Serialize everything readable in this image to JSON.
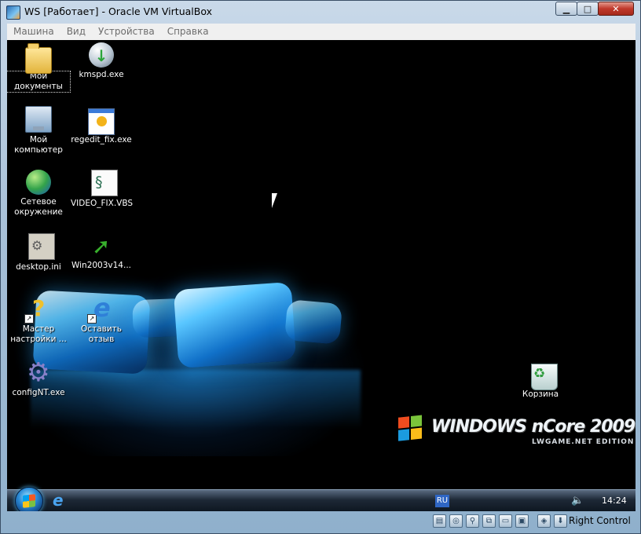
{
  "window": {
    "title": "WS [Работает] - Oracle VM VirtualBox",
    "buttons": {
      "minimize": "▁",
      "maximize": "□",
      "close": "✕"
    }
  },
  "menu": [
    "Машина",
    "Вид",
    "Устройства",
    "Справка"
  ],
  "desktop_icons": [
    {
      "label_1": "Мои",
      "label_2": "документы",
      "icon": "my-documents-folder-icon"
    },
    {
      "label_1": "kmspd.exe",
      "label_2": "",
      "icon": "globe-download-icon"
    },
    {
      "label_1": "Мой",
      "label_2": "компьютер",
      "icon": "computer-icon"
    },
    {
      "label_1": "regedit_fix.exe",
      "label_2": "",
      "icon": "application-icon"
    },
    {
      "label_1": "Сетевое",
      "label_2": "окружение",
      "icon": "network-globe-icon"
    },
    {
      "label_1": "VIDEO_FIX.VBS",
      "label_2": "",
      "icon": "script-icon"
    },
    {
      "label_1": "desktop.ini",
      "label_2": "",
      "icon": "ini-file-icon"
    },
    {
      "label_1": "Win2003v14...",
      "label_2": "",
      "icon": "green-arrow-icon"
    },
    {
      "label_1": "Мастер",
      "label_2": "настройки ...",
      "icon": "wizard-icon"
    },
    {
      "label_1": "Оставить",
      "label_2": "отзыв",
      "icon": "internet-explorer-icon"
    },
    {
      "label_1": "configNT.exe",
      "label_2": "",
      "icon": "gear-icon"
    },
    {
      "label_1": "Корзина",
      "label_2": "",
      "icon": "recycle-bin-icon"
    }
  ],
  "wallpaper": {
    "brand": "WINDOWS nCore 2009",
    "edition": "LWGAME.NET EDITION"
  },
  "taskbar": {
    "language": "RU",
    "clock": "14:24"
  },
  "statusbar": {
    "host_key": "Right Control",
    "icons": [
      "hard-disk-icon",
      "optical-drive-icon",
      "usb-icon",
      "network-icon",
      "shared-folders-icon",
      "display-icon",
      "guest-additions-icon",
      "mouse-integration-icon"
    ]
  },
  "colors": {
    "window_frame": "#a9c1d8",
    "desktop": "#000000",
    "close_button": "#c0392b"
  }
}
